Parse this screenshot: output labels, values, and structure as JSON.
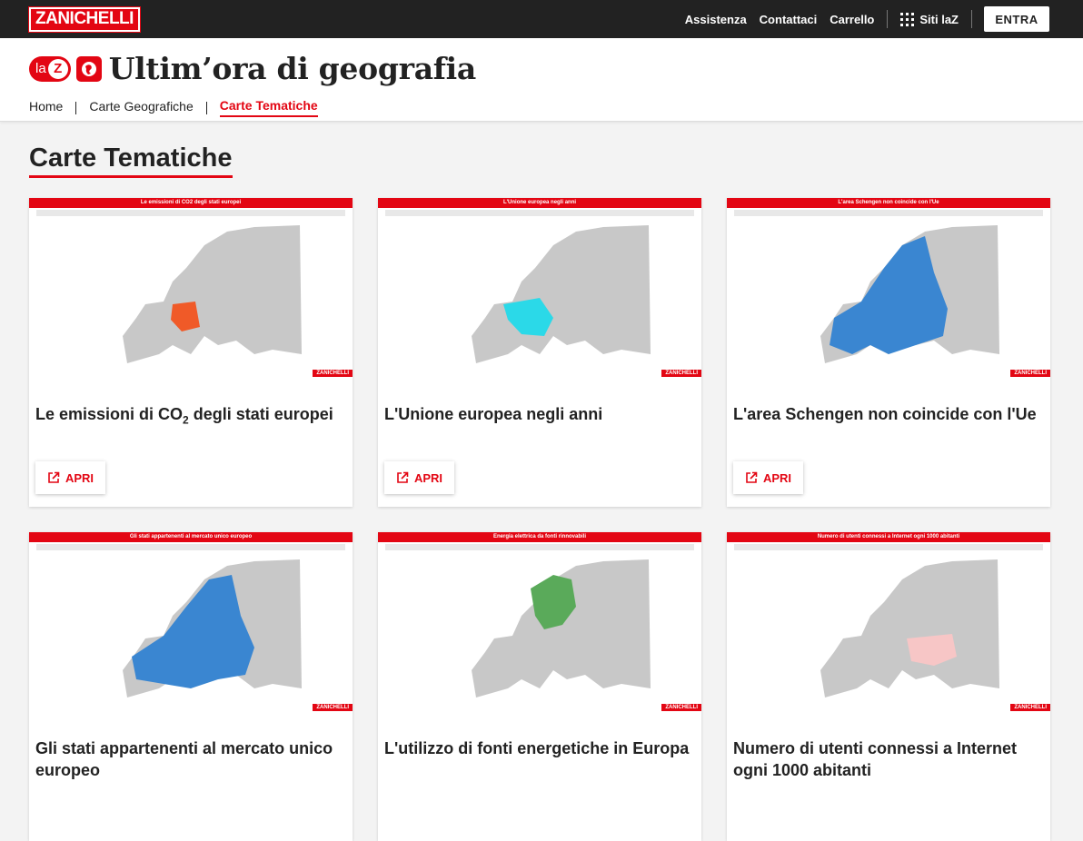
{
  "topbar": {
    "logo": "ZANICHELLI",
    "links": [
      "Assistenza",
      "Contattaci",
      "Carrello"
    ],
    "siti_label": "Siti laZ",
    "entra_label": "ENTRA"
  },
  "header": {
    "laz_la": "la",
    "laz_z": "Z",
    "title": "Ultim’ora di geografia",
    "breadcrumb": [
      "Home",
      "Carte Geografiche",
      "Carte Tematiche"
    ]
  },
  "page": {
    "title": "Carte Tematiche"
  },
  "cards": [
    {
      "title": "Le emissioni di CO",
      "title_sub": "2",
      "title_rest": " degli stati europei",
      "thumb_title": "Le emissioni di CO2 degli stati europei",
      "button": "APRI",
      "highlight": "#f05a28"
    },
    {
      "title": "L'Unione europea negli anni",
      "title_sub": "",
      "title_rest": "",
      "thumb_title": "L'Unione europea negli anni",
      "button": "APRI",
      "highlight": "#2bd9e8"
    },
    {
      "title": "L'area Schengen non coincide con l'Ue",
      "title_sub": "",
      "title_rest": "",
      "thumb_title": "L'area Schengen non coincide con l'Ue",
      "button": "APRI",
      "highlight": "#3a86d1"
    },
    {
      "title": "Gli stati appartenenti al mercato unico europeo",
      "title_sub": "",
      "title_rest": "",
      "thumb_title": "Gli stati appartenenti al mercato unico europeo",
      "button": "APRI",
      "highlight": "#3a86d1"
    },
    {
      "title": "L'utilizzo di fonti energetiche in Europa",
      "title_sub": "",
      "title_rest": "",
      "thumb_title": "Energia elettrica da fonti rinnovabili",
      "button": "APRI",
      "highlight": "#5aaa5a"
    },
    {
      "title": "Numero di utenti connessi a Internet ogni 1000 abitanti",
      "title_sub": "",
      "title_rest": "",
      "thumb_title": "Numero di utenti connessi a Internet ogni 1000 abitanti",
      "button": "APRI",
      "highlight": "#f7c6c6"
    }
  ],
  "thumb_tag": "ZANICHELLI",
  "colors": {
    "brand_red": "#e30613",
    "topbar": "#222222"
  }
}
